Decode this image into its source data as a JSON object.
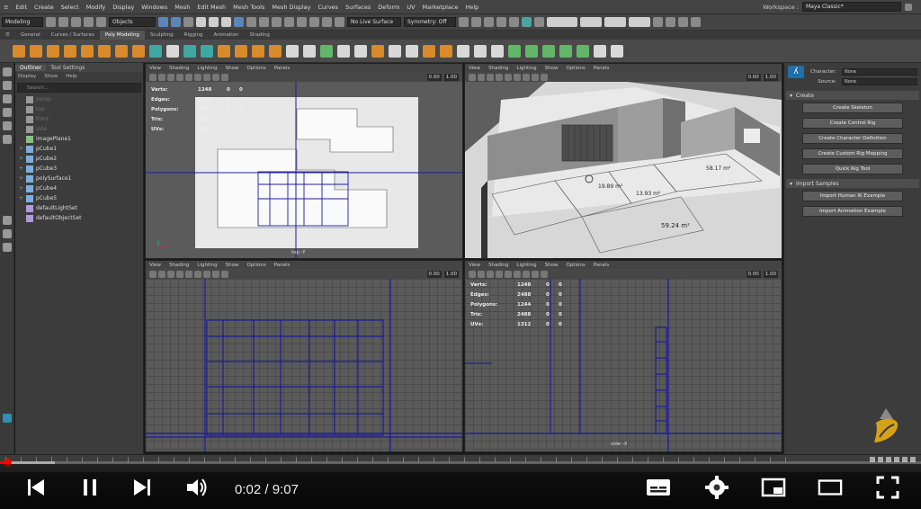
{
  "menubar": {
    "items": [
      "Edit",
      "Create",
      "Select",
      "Modify",
      "Display",
      "Windows",
      "Mesh",
      "Edit Mesh",
      "Mesh Tools",
      "Mesh Display",
      "Curves",
      "Surfaces",
      "Deform",
      "UV",
      "Marketplace",
      "Help"
    ],
    "workspace_label": "Workspace :",
    "workspace_value": "Maya Classic*"
  },
  "statusline": {
    "mode_value": "Modeling",
    "select_mode": "Objects",
    "live_surface": "No Live Surface",
    "symmetry": "Symmetry: Off"
  },
  "shelf_tabs": {
    "items": [
      "General",
      "Curves / Surfaces",
      "Poly Modeling",
      "Sculpting",
      "Rigging",
      "Animation",
      "Shading"
    ],
    "active": "Poly Modeling"
  },
  "outliner": {
    "tabs": [
      "Outliner",
      "Tool Settings"
    ],
    "menu": [
      "Display",
      "Show",
      "Help"
    ],
    "search_placeholder": "Search...",
    "items": [
      {
        "label": "persp",
        "dim": true,
        "icon": "cam"
      },
      {
        "label": "top",
        "dim": true,
        "icon": "cam"
      },
      {
        "label": "front",
        "dim": true,
        "icon": "cam"
      },
      {
        "label": "side",
        "dim": true,
        "icon": "cam"
      },
      {
        "label": "imagePlane1",
        "dim": false,
        "icon": "img"
      },
      {
        "label": "pCube1",
        "dim": false,
        "icon": "mesh",
        "plus": true
      },
      {
        "label": "pCube2",
        "dim": false,
        "icon": "mesh",
        "plus": true
      },
      {
        "label": "pCube3",
        "dim": false,
        "icon": "mesh",
        "plus": true
      },
      {
        "label": "polySurface1",
        "dim": false,
        "icon": "mesh",
        "plus": true
      },
      {
        "label": "pCube4",
        "dim": false,
        "icon": "mesh",
        "plus": true
      },
      {
        "label": "pCube5",
        "dim": false,
        "icon": "mesh",
        "plus": true
      },
      {
        "label": "defaultLightSet",
        "dim": false,
        "icon": "set"
      },
      {
        "label": "defaultObjectSet",
        "dim": false,
        "icon": "set"
      }
    ]
  },
  "viewport": {
    "menu": [
      "View",
      "Shading",
      "Lighting",
      "Show",
      "Options",
      "Panels"
    ],
    "num_a": "0.00",
    "num_b": "1.00",
    "hud_keys": [
      "Verts:",
      "Edges:",
      "Polygons:",
      "Tris:",
      "UVs:"
    ],
    "hud_values": [
      "1248",
      "2488",
      "1244",
      "2488",
      "1312"
    ],
    "hud_zero": "0",
    "top_label": "top -Y",
    "side_label": "side -X",
    "room_labels": [
      "59.24 m²",
      "13.93 m²",
      "19.89 m²",
      "58.17 m²"
    ]
  },
  "right_panel": {
    "character_label": "Character:",
    "character_value": "None",
    "source_label": "Source:",
    "source_value": "None",
    "create_section": "Create",
    "create_buttons": [
      "Create Skeleton",
      "Create Control Rig",
      "Create Character Definition",
      "Create Custom Rig Mapping",
      "Quick Rig Tool"
    ],
    "import_section": "Import Samples",
    "import_buttons": [
      "Import Human IK Example",
      "Import Animation Example"
    ]
  },
  "player": {
    "current_time": "0:02",
    "duration": "9:07",
    "progress": 0.004,
    "buffered": 0.06,
    "timecode_sep": " / "
  },
  "colors": {
    "accent_red": "#ff0000",
    "wire_blue": "#1c1c9c",
    "hik_blue": "#1f6fa8"
  }
}
